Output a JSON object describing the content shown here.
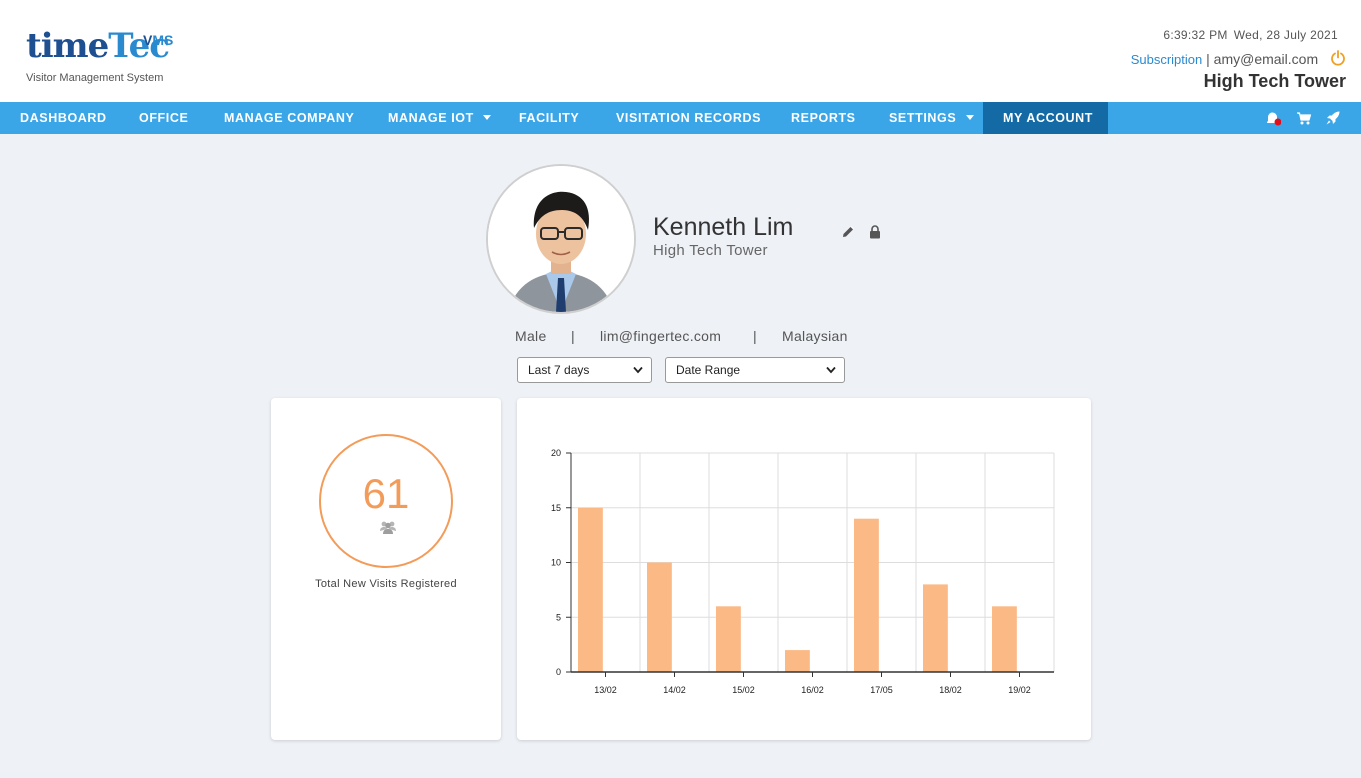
{
  "header": {
    "logo_time": "time",
    "logo_tec": "Tec",
    "logo_v": "V",
    "logo_ms": "MS",
    "logo_subtitle": "Visitor Management System",
    "time": "6:39:32 PM",
    "date": "Wed, 28 July 2021",
    "subscription_label": "Subscription",
    "separator": "|",
    "email": "amy@email.com",
    "building": "High Tech Tower"
  },
  "nav": {
    "items": [
      {
        "label": "DASHBOARD"
      },
      {
        "label": "OFFICE"
      },
      {
        "label": "MANAGE COMPANY"
      },
      {
        "label": "MANAGE IOT"
      },
      {
        "label": "FACILITY"
      },
      {
        "label": "VISITATION RECORDS"
      },
      {
        "label": "REPORTS"
      },
      {
        "label": "SETTINGS"
      },
      {
        "label": "MY ACCOUNT"
      }
    ],
    "active": "MY ACCOUNT",
    "icons": [
      "notification-icon",
      "cart-icon",
      "rocket-icon"
    ]
  },
  "profile": {
    "name": "Kenneth Lim",
    "organization": "High Tech Tower",
    "gender": "Male",
    "email": "lim@fingertec.com",
    "nationality": "Malaysian",
    "separator": "|"
  },
  "filters": {
    "period": "Last 7 days",
    "range": "Date Range"
  },
  "stats": {
    "total_visits": "61",
    "total_visits_label": "Total New Visits Registered"
  },
  "colors": {
    "nav_bg": "#3aa6e8",
    "nav_active": "#136aa5",
    "accent_orange": "#f39c5a",
    "bar_fill": "#fbb985",
    "link": "#2a8ad0"
  },
  "chart_data": {
    "type": "bar",
    "categories": [
      "13/02",
      "14/02",
      "15/02",
      "16/02",
      "17/05",
      "18/02",
      "19/02"
    ],
    "values": [
      15,
      10,
      6,
      2,
      14,
      8,
      6
    ],
    "ylim": [
      0,
      20
    ],
    "yticks": [
      0,
      5,
      10,
      15,
      20
    ],
    "grid": true
  }
}
